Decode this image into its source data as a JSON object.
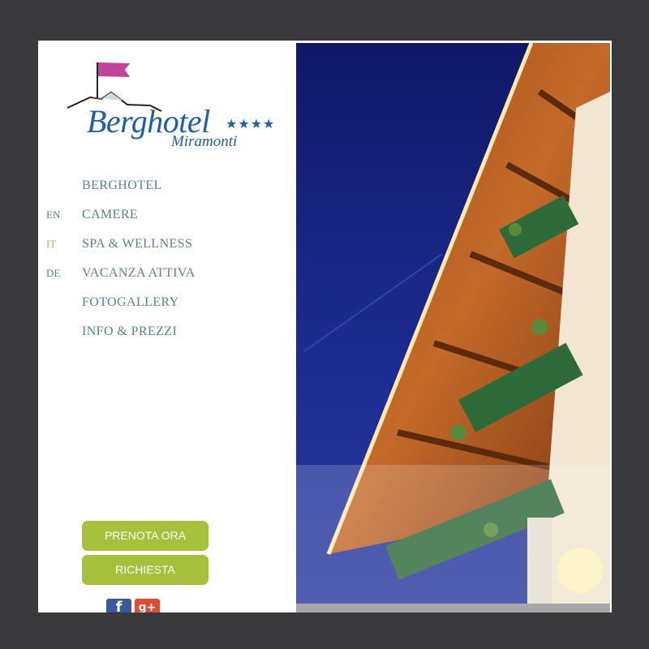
{
  "brand": {
    "name": "Berghotel",
    "stars": "★★★★",
    "sub": "Miramonti"
  },
  "languages": [
    {
      "code": "EN",
      "color": "#5d7e96"
    },
    {
      "code": "IT",
      "color": "#a6c13c"
    },
    {
      "code": "DE",
      "color": "#5d7e96"
    }
  ],
  "nav": [
    {
      "label": "BERGHOTEL"
    },
    {
      "label": "CAMERE"
    },
    {
      "label": "SPA & WELLNESS"
    },
    {
      "label": "VACANZA ATTIVA"
    },
    {
      "label": "FOTOGALLERY"
    },
    {
      "label": "INFO & PREZZI"
    }
  ],
  "buttons": {
    "book": "PRENOTA ORA",
    "request": "RICHIESTA"
  },
  "social": {
    "facebook": "f",
    "google": "g+"
  },
  "colors": {
    "accent": "#a6c13c",
    "brand_blue": "#1f5fa5",
    "nav_text": "#5d7e96",
    "background": "#3a393c",
    "flag": "#c2449a"
  },
  "icons": {
    "flag": "flag-icon",
    "facebook": "facebook-icon",
    "google": "google-plus-icon"
  }
}
